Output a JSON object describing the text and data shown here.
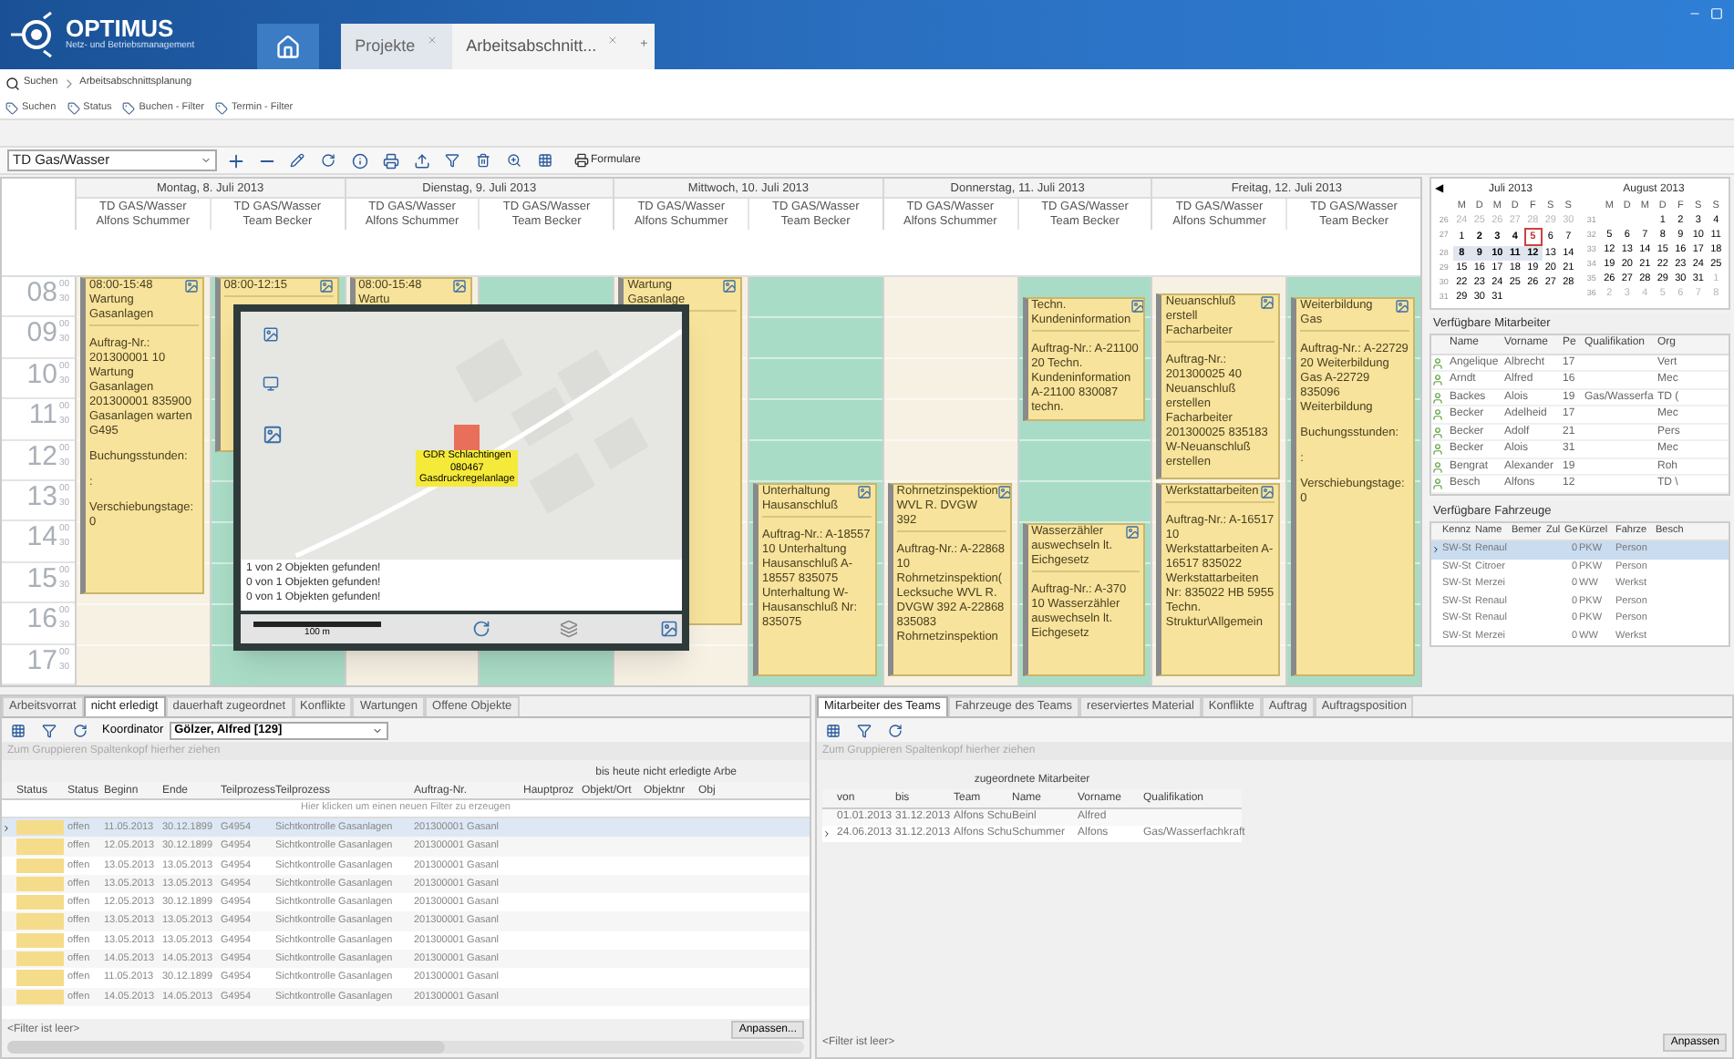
{
  "app": {
    "title": "OPTIMUS",
    "subtitle": "Netz- und Betriebsmanagement"
  },
  "tabs": [
    {
      "label": "Projekte",
      "selected": false
    },
    {
      "label": "Arbeitsabschnitt...",
      "selected": true
    }
  ],
  "add_tab": "+",
  "breadcrumb": [
    "Suchen",
    "Arbeitsabschnittsplanung"
  ],
  "filters": [
    "Suchen",
    "Status",
    "Buchen - Filter",
    "Termin - Filter"
  ],
  "toolbar": {
    "dropdown": "TD Gas/Wasser",
    "forms_button": "Formulare"
  },
  "calendar": {
    "hours": [
      {
        "hour": "08",
        "marks": [
          "00",
          "30"
        ]
      },
      {
        "hour": "09",
        "marks": [
          "00",
          "30"
        ]
      },
      {
        "hour": "10",
        "marks": [
          "00",
          "30"
        ]
      },
      {
        "hour": "11",
        "marks": [
          "00",
          "30"
        ]
      },
      {
        "hour": "12",
        "marks": [
          "00",
          "30"
        ]
      },
      {
        "hour": "13",
        "marks": [
          "00",
          "30"
        ]
      },
      {
        "hour": "14",
        "marks": [
          "00",
          "30"
        ]
      },
      {
        "hour": "15",
        "marks": [
          "00",
          "30"
        ]
      },
      {
        "hour": "16",
        "marks": [
          "00",
          "30"
        ]
      },
      {
        "hour": "17",
        "marks": [
          "00",
          "30"
        ]
      }
    ],
    "days": [
      {
        "label": "Montag, 8. Juli 2013",
        "columns": [
          {
            "line1": "TD GAS/Wasser",
            "line2": "Alfons Schummer",
            "kind": "person",
            "events": [
              {
                "kind": "workday",
                "title": "08:00-15:48 Wartung Gasanlagen",
                "body": [
                  "Auftrag-Nr.: 201300001 10 Wartung Gasanlagen 201300001 835900 Gasanlagen warten G495",
                  "Buchungsstunden:",
                  ":",
                  "Verschiebungstage: 0"
                ]
              }
            ]
          },
          {
            "line1": "TD GAS/Wasser",
            "line2": "Team Becker",
            "kind": "team",
            "events": [
              {
                "kind": "morning",
                "title": "08:00-12:15"
              }
            ]
          }
        ]
      },
      {
        "label": "Dienstag, 9. Juli 2013",
        "columns": [
          {
            "line1": "TD GAS/Wasser",
            "line2": "Alfons Schummer",
            "kind": "person",
            "events": [
              {
                "kind": "workday",
                "title": "08:00-15:48 Wartu"
              }
            ]
          },
          {
            "line1": "TD GAS/Wasser",
            "line2": "Team Becker",
            "kind": "team"
          }
        ]
      },
      {
        "label": "Mittwoch, 10. Juli 2013",
        "columns": [
          {
            "line1": "TD GAS/Wasser",
            "line2": "Alfons Schummer",
            "kind": "person",
            "events": [
              {
                "kind": "extended",
                "title": "Wartung Gasanlage"
              }
            ]
          },
          {
            "line1": "TD GAS/Wasser",
            "line2": "Team Becker",
            "kind": "team",
            "events": [
              {
                "kind": "afternoon",
                "title": "Unterhaltung Hausanschluß",
                "body": [
                  "Auftrag-Nr.: A-18557 10 Unterhaltung Hausanschluß A-18557 835075 Unterhaltung W-Hausanschluß Nr: 835075"
                ]
              }
            ]
          }
        ]
      },
      {
        "label": "Donnerstag, 11. Juli 2013",
        "columns": [
          {
            "line1": "TD GAS/Wasser",
            "line2": "Alfons Schummer",
            "kind": "person",
            "events": [
              {
                "kind": "afternoon",
                "title": "Rohrnetzinspektion WVL R. DVGW 392",
                "body": [
                  "Auftrag-Nr.: A-22868 10 Rohrnetzinspektion(Lecksuche WVL R. DVGW 392 A-22868 835083 Rohrnetzinspektion"
                ]
              }
            ]
          },
          {
            "line1": "TD GAS/Wasser",
            "line2": "Team Becker",
            "kind": "team",
            "events": [
              {
                "kind": "forenoon",
                "title": "Techn. Kundeninformation",
                "body": [
                  "Auftrag-Nr.: A-21100 20 Techn. Kundeninformation A-21100 830087 techn."
                ]
              },
              {
                "kind": "late",
                "title": "Wasserzähler auswechseln lt. Eichgesetz",
                "body": [
                  "Auftrag-Nr.: A-370 10 Wasserzähler auswechseln lt. Eichgesetz"
                ]
              }
            ]
          }
        ]
      },
      {
        "label": "Freitag, 12. Juli 2013",
        "columns": [
          {
            "line1": "TD GAS/Wasser",
            "line2": "Alfons Schummer",
            "kind": "person",
            "events": [
              {
                "kind": "midday",
                "title": "Neuanschluß erstell Facharbeiter",
                "body": [
                  "Auftrag-Nr.: 201300025 40 Neuanschluß erstellen Facharbeiter 201300025 835183 W-Neuanschluß erstellen"
                ]
              },
              {
                "kind": "afternoon",
                "title": "Werkstattarbeiten",
                "body": [
                  "Auftrag-Nr.: A-16517 10 Werkstattarbeiten A-16517 835022 Werkstattarbeiten Nr: 835022 HB 5955 Techn. Struktur\\Allgemein"
                ]
              }
            ]
          },
          {
            "line1": "TD GAS/Wasser",
            "line2": "Team Becker",
            "kind": "team",
            "events": [
              {
                "kind": "long",
                "title": "Weiterbildung Gas",
                "body": [
                  "Auftrag-Nr.: A-22729 20 Weiterbildung Gas A-22729 835096 Weiterbildung",
                  "Buchungsstunden:",
                  ":",
                  "Verschiebungstage: 0"
                ]
              }
            ]
          }
        ]
      }
    ]
  },
  "map_popup": {
    "marker": [
      "GDR Schlachtingen",
      "080467",
      "Gasdruckregelanlage"
    ],
    "messages": [
      "1 von 2 Objekten gefunden!",
      "0 von 1 Objekten gefunden!",
      "0 von 1 Objekten gefunden!"
    ],
    "scale": "100 m"
  },
  "mini_calendar": {
    "prev": "◀",
    "months": [
      {
        "title": "Juli 2013",
        "weekdays": [
          "M",
          "D",
          "M",
          "D",
          "F",
          "S",
          "S"
        ],
        "weeks": [
          {
            "no": "26",
            "days": [
              {
                "d": "24",
                "kind": "other"
              },
              {
                "d": "25",
                "kind": "other"
              },
              {
                "d": "26",
                "kind": "other"
              },
              {
                "d": "27",
                "kind": "other"
              },
              {
                "d": "28",
                "kind": "other"
              },
              {
                "d": "29",
                "kind": "other"
              },
              {
                "d": "30",
                "kind": "other"
              }
            ]
          },
          {
            "no": "27",
            "days": [
              {
                "d": "1",
                "kind": "normal"
              },
              {
                "d": "2",
                "kind": "busy"
              },
              {
                "d": "3",
                "kind": "busy"
              },
              {
                "d": "4",
                "kind": "busy"
              },
              {
                "d": "5",
                "kind": "today"
              },
              {
                "d": "6",
                "kind": "normal"
              },
              {
                "d": "7",
                "kind": "normal"
              }
            ]
          },
          {
            "no": "28",
            "days": [
              {
                "d": "8",
                "kind": "range"
              },
              {
                "d": "9",
                "kind": "range"
              },
              {
                "d": "10",
                "kind": "range"
              },
              {
                "d": "11",
                "kind": "range"
              },
              {
                "d": "12",
                "kind": "range"
              },
              {
                "d": "13",
                "kind": "normal"
              },
              {
                "d": "14",
                "kind": "normal"
              }
            ]
          },
          {
            "no": "29",
            "days": [
              {
                "d": "15",
                "kind": "normal"
              },
              {
                "d": "16",
                "kind": "normal"
              },
              {
                "d": "17",
                "kind": "normal"
              },
              {
                "d": "18",
                "kind": "normal"
              },
              {
                "d": "19",
                "kind": "normal"
              },
              {
                "d": "20",
                "kind": "normal"
              },
              {
                "d": "21",
                "kind": "normal"
              }
            ]
          },
          {
            "no": "30",
            "days": [
              {
                "d": "22",
                "kind": "normal"
              },
              {
                "d": "23",
                "kind": "normal"
              },
              {
                "d": "24",
                "kind": "normal"
              },
              {
                "d": "25",
                "kind": "normal"
              },
              {
                "d": "26",
                "kind": "normal"
              },
              {
                "d": "27",
                "kind": "normal"
              },
              {
                "d": "28",
                "kind": "normal"
              }
            ]
          },
          {
            "no": "31",
            "days": [
              {
                "d": "29",
                "kind": "normal"
              },
              {
                "d": "30",
                "kind": "normal"
              },
              {
                "d": "31",
                "kind": "normal"
              }
            ]
          }
        ]
      },
      {
        "title": "August 2013",
        "weekdays": [
          "M",
          "D",
          "M",
          "D",
          "F",
          "S",
          "S"
        ],
        "weeks": [
          {
            "no": "31",
            "days": [
              {
                "kind": "empty"
              },
              {
                "kind": "empty"
              },
              {
                "kind": "empty"
              },
              {
                "d": "1",
                "kind": "normal"
              },
              {
                "d": "2",
                "kind": "normal"
              },
              {
                "d": "3",
                "kind": "normal"
              },
              {
                "d": "4",
                "kind": "normal"
              }
            ]
          },
          {
            "no": "32",
            "days": [
              {
                "d": "5",
                "kind": "normal"
              },
              {
                "d": "6",
                "kind": "normal"
              },
              {
                "d": "7",
                "kind": "normal"
              },
              {
                "d": "8",
                "kind": "normal"
              },
              {
                "d": "9",
                "kind": "normal"
              },
              {
                "d": "10",
                "kind": "normal"
              },
              {
                "d": "11",
                "kind": "normal"
              }
            ]
          },
          {
            "no": "33",
            "days": [
              {
                "d": "12",
                "kind": "normal"
              },
              {
                "d": "13",
                "kind": "normal"
              },
              {
                "d": "14",
                "kind": "normal"
              },
              {
                "d": "15",
                "kind": "normal"
              },
              {
                "d": "16",
                "kind": "normal"
              },
              {
                "d": "17",
                "kind": "normal"
              },
              {
                "d": "18",
                "kind": "normal"
              }
            ]
          },
          {
            "no": "34",
            "days": [
              {
                "d": "19",
                "kind": "normal"
              },
              {
                "d": "20",
                "kind": "normal"
              },
              {
                "d": "21",
                "kind": "normal"
              },
              {
                "d": "22",
                "kind": "normal"
              },
              {
                "d": "23",
                "kind": "normal"
              },
              {
                "d": "24",
                "kind": "normal"
              },
              {
                "d": "25",
                "kind": "normal"
              }
            ]
          },
          {
            "no": "35",
            "days": [
              {
                "d": "26",
                "kind": "normal"
              },
              {
                "d": "27",
                "kind": "normal"
              },
              {
                "d": "28",
                "kind": "normal"
              },
              {
                "d": "29",
                "kind": "normal"
              },
              {
                "d": "30",
                "kind": "normal"
              },
              {
                "d": "31",
                "kind": "normal"
              },
              {
                "d": "1",
                "kind": "other"
              }
            ]
          },
          {
            "no": "36",
            "days": [
              {
                "d": "2",
                "kind": "other"
              },
              {
                "d": "3",
                "kind": "other"
              },
              {
                "d": "4",
                "kind": "other"
              },
              {
                "d": "5",
                "kind": "other"
              },
              {
                "d": "6",
                "kind": "other"
              },
              {
                "d": "7",
                "kind": "other"
              },
              {
                "d": "8",
                "kind": "other"
              }
            ]
          }
        ]
      }
    ]
  },
  "employees": {
    "title": "Verfügbare Mitarbeiter",
    "columns": [
      "Name",
      "Vorname",
      "Pe",
      "Qualifikation",
      "Org"
    ],
    "rows": [
      [
        "Angelique",
        "Albrecht",
        "17",
        "",
        "Vert"
      ],
      [
        "Arndt",
        "Alfred",
        "16",
        "",
        "Mec"
      ],
      [
        "Backes",
        "Alois",
        "19",
        "Gas/Wasserfa",
        "TD ("
      ],
      [
        "Becker",
        "Adelheid",
        "17",
        "",
        "Mec"
      ],
      [
        "Becker",
        "Adolf",
        "21",
        "",
        "Pers"
      ],
      [
        "Becker",
        "Alois",
        "31",
        "",
        "Mec"
      ],
      [
        "Bengrat",
        "Alexander",
        "19",
        "",
        "Roh"
      ],
      [
        "Besch",
        "Alfons",
        "12",
        "",
        "TD \\"
      ]
    ]
  },
  "vehicles": {
    "title": "Verfügbare Fahrzeuge",
    "columns": [
      "Kennz",
      "Name",
      "Bemer",
      "Zul",
      "Ge",
      "Kürzel",
      "Fahrze",
      "Besch"
    ],
    "rows": [
      {
        "selected": true,
        "cells": [
          "SW-St",
          "Renaul",
          "",
          "",
          "0",
          "PKW",
          "Person",
          ""
        ]
      },
      {
        "selected": false,
        "cells": [
          "SW-St",
          "Citroer",
          "",
          "",
          "0",
          "PKW",
          "Person",
          ""
        ]
      },
      {
        "selected": false,
        "cells": [
          "SW-St",
          "Merzei",
          "",
          "",
          "0",
          "WW",
          "Werkst",
          ""
        ]
      },
      {
        "selected": false,
        "cells": [
          "SW-St",
          "Renaul",
          "",
          "",
          "0",
          "PKW",
          "Person",
          ""
        ]
      },
      {
        "selected": false,
        "cells": [
          "SW-St",
          "Renaul",
          "",
          "",
          "0",
          "PKW",
          "Person",
          ""
        ]
      },
      {
        "selected": false,
        "cells": [
          "SW-St",
          "Merzei",
          "",
          "",
          "0",
          "WW",
          "Werkst",
          ""
        ]
      }
    ]
  },
  "left_panel": {
    "tabs": [
      {
        "label": "Arbeitsvorrat",
        "selected": false
      },
      {
        "label": "nicht erledigt",
        "selected": true
      },
      {
        "label": "dauerhaft zugeordnet",
        "selected": false
      },
      {
        "label": "Konflikte",
        "selected": false
      },
      {
        "label": "Wartungen",
        "selected": false
      },
      {
        "label": "Offene Objekte",
        "selected": false
      }
    ],
    "coordinator_label": "Koordinator",
    "coordinator": "Gölzer, Alfred [129]",
    "group_hint": "Zum Gruppieren Spaltenkopf hierher ziehen",
    "caption": "bis heute nicht erledigte Arbe",
    "columns": [
      "Status",
      "Status",
      "Beginn",
      "Ende",
      "Teilprozess",
      "Teilprozess",
      "Auftrag-Nr.",
      "Hauptproz",
      "Objekt/Ort",
      "Objektnr",
      "Obj"
    ],
    "filter_hint": "Hier klicken um einen neuen Filter zu erzeugen",
    "rows": [
      {
        "selected": true,
        "color": "#f5dc8a",
        "cells": [
          "",
          "offen",
          "11.05.2013",
          "30.12.1899",
          "G4954",
          "Sichtkontrolle Gasanlagen",
          "201300001 Gasanl"
        ]
      },
      {
        "selected": false,
        "color": "#f5dc8a",
        "cells": [
          "",
          "offen",
          "12.05.2013",
          "30.12.1899",
          "G4954",
          "Sichtkontrolle Gasanlagen",
          "201300001 Gasanl"
        ]
      },
      {
        "selected": false,
        "color": "#f5dc8a",
        "cells": [
          "",
          "offen",
          "13.05.2013",
          "13.05.2013",
          "G4954",
          "Sichtkontrolle Gasanlagen",
          "201300001 Gasanl"
        ]
      },
      {
        "selected": false,
        "color": "#f5dc8a",
        "cells": [
          "",
          "offen",
          "13.05.2013",
          "13.05.2013",
          "G4954",
          "Sichtkontrolle Gasanlagen",
          "201300001 Gasanl"
        ]
      },
      {
        "selected": false,
        "color": "#f5dc8a",
        "cells": [
          "",
          "offen",
          "12.05.2013",
          "30.12.1899",
          "G4954",
          "Sichtkontrolle Gasanlagen",
          "201300001 Gasanl"
        ]
      },
      {
        "selected": false,
        "color": "#f5dc8a",
        "cells": [
          "",
          "offen",
          "13.05.2013",
          "13.05.2013",
          "G4954",
          "Sichtkontrolle Gasanlagen",
          "201300001 Gasanl"
        ]
      },
      {
        "selected": false,
        "color": "#f5dc8a",
        "cells": [
          "",
          "offen",
          "13.05.2013",
          "13.05.2013",
          "G4954",
          "Sichtkontrolle Gasanlagen",
          "201300001 Gasanl"
        ]
      },
      {
        "selected": false,
        "color": "#f5dc8a",
        "cells": [
          "",
          "offen",
          "14.05.2013",
          "14.05.2013",
          "G4954",
          "Sichtkontrolle Gasanlagen",
          "201300001 Gasanl"
        ]
      },
      {
        "selected": false,
        "color": "#f5dc8a",
        "cells": [
          "",
          "offen",
          "11.05.2013",
          "30.12.1899",
          "G4954",
          "Sichtkontrolle Gasanlagen",
          "201300001 Gasanl"
        ]
      },
      {
        "selected": false,
        "color": "#f5dc8a",
        "cells": [
          "",
          "offen",
          "14.05.2013",
          "14.05.2013",
          "G4954",
          "Sichtkontrolle Gasanlagen",
          "201300001 Gasanl"
        ]
      }
    ],
    "filter_status": "<Filter ist leer>",
    "customize": "Anpassen..."
  },
  "right_panel": {
    "tabs": [
      {
        "label": "Mitarbeiter des Teams",
        "selected": true
      },
      {
        "label": "Fahrzeuge des Teams",
        "selected": false
      },
      {
        "label": "reserviertes Material",
        "selected": false
      },
      {
        "label": "Konflikte",
        "selected": false
      },
      {
        "label": "Auftrag",
        "selected": false
      },
      {
        "label": "Auftragsposition",
        "selected": false
      }
    ],
    "group_hint": "Zum Gruppieren Spaltenkopf hierher ziehen",
    "caption": "zugeordnete Mitarbeiter",
    "columns": [
      "von",
      "bis",
      "Team",
      "Name",
      "Vorname",
      "Qualifikation"
    ],
    "rows": [
      {
        "selected": false,
        "cells": [
          "01.01.2013",
          "31.12.2013",
          "Alfons Schu",
          "Beinl",
          "Alfred",
          ""
        ]
      },
      {
        "selected": true,
        "cells": [
          "24.06.2013",
          "31.12.2013",
          "Alfons Schu",
          "Schummer",
          "Alfons",
          "Gas/Wasserfachkraft"
        ]
      }
    ],
    "filter_status": "<Filter ist leer>",
    "customize": "Anpassen"
  }
}
